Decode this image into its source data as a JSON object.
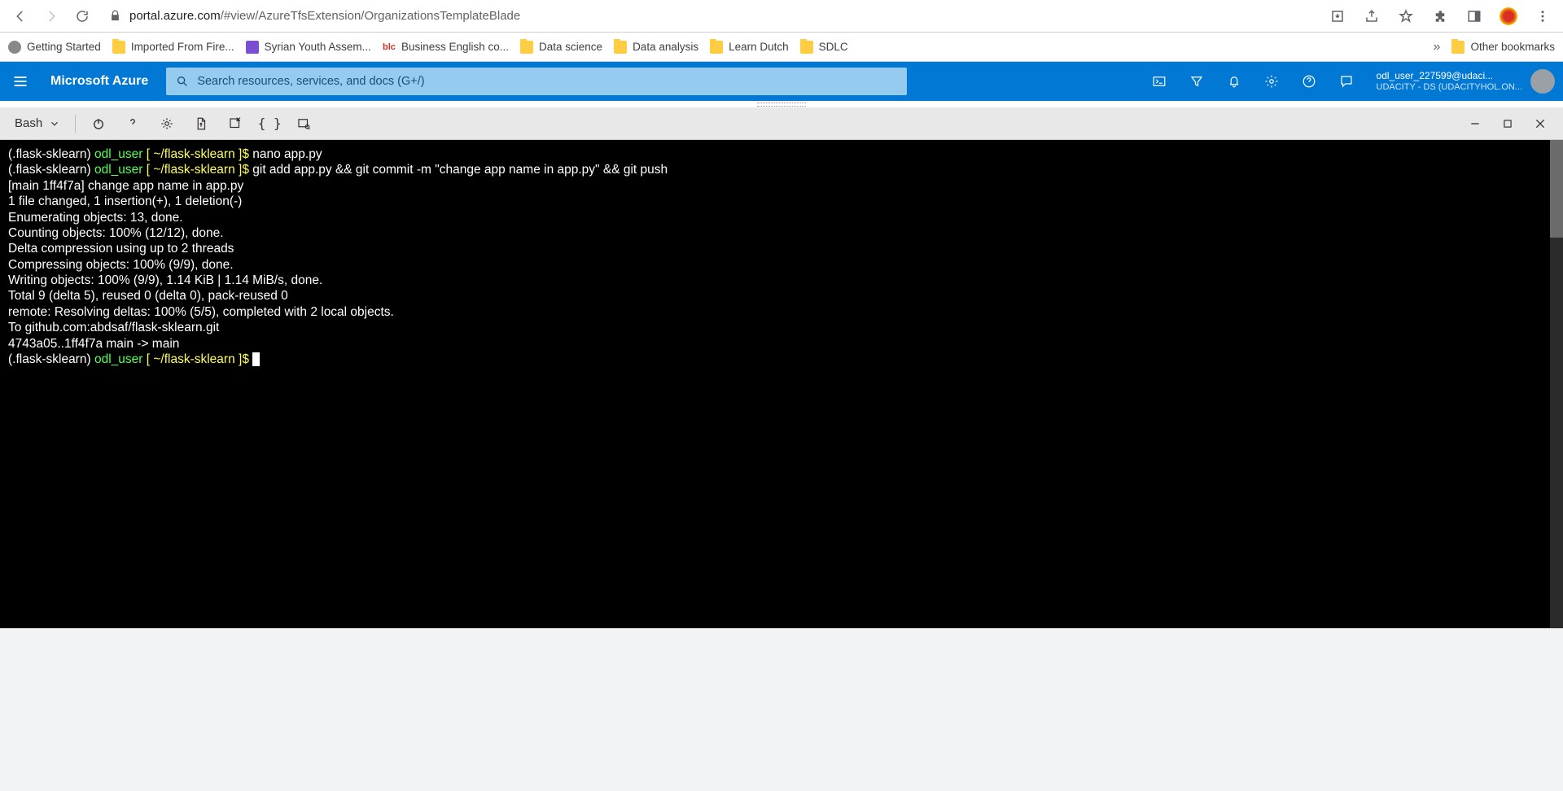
{
  "browser": {
    "url_locked": true,
    "url_host": "portal.azure.com",
    "url_path": "/#view/AzureTfsExtension/OrganizationsTemplateBlade"
  },
  "bookmarks": {
    "items": [
      {
        "label": "Getting Started",
        "iconType": "globe"
      },
      {
        "label": "Imported From Fire...",
        "iconType": "folder"
      },
      {
        "label": "Syrian Youth Assem...",
        "iconType": "purple"
      },
      {
        "label": "Business English co...",
        "iconType": "red"
      },
      {
        "label": "Data science",
        "iconType": "folder"
      },
      {
        "label": "Data analysis",
        "iconType": "folder"
      },
      {
        "label": "Learn Dutch",
        "iconType": "folder"
      },
      {
        "label": "SDLC",
        "iconType": "folder"
      }
    ],
    "overflow": "»",
    "other": "Other bookmarks"
  },
  "azure": {
    "brand": "Microsoft Azure",
    "search_placeholder": "Search resources, services, and docs (G+/)",
    "account_line1": "odl_user_227599@udaci...",
    "account_line2": "UDACITY - DS (UDACITYHOL.ON..."
  },
  "cloudshell": {
    "shell": "Bash"
  },
  "terminal": {
    "prompts": [
      {
        "env": "(.flask-sklearn)",
        "user": "odl_user",
        "sep1": " [ ",
        "path": "~/flask-sklearn",
        "sep2": " ]$ ",
        "cmd": "nano app.py"
      },
      {
        "env": "(.flask-sklearn)",
        "user": "odl_user",
        "sep1": " [ ",
        "path": "~/flask-sklearn",
        "sep2": " ]$ ",
        "cmd": "git add app.py && git commit -m \"change app name in app.py\" && git push"
      }
    ],
    "output": [
      "[main 1ff4f7a] change app name in app.py",
      " 1 file changed, 1 insertion(+), 1 deletion(-)",
      "Enumerating objects: 13, done.",
      "Counting objects: 100% (12/12), done.",
      "Delta compression using up to 2 threads",
      "Compressing objects: 100% (9/9), done.",
      "Writing objects: 100% (9/9), 1.14 KiB | 1.14 MiB/s, done.",
      "Total 9 (delta 5), reused 0 (delta 0), pack-reused 0",
      "remote: Resolving deltas: 100% (5/5), completed with 2 local objects.",
      "To github.com:abdsaf/flask-sklearn.git",
      "   4743a05..1ff4f7a  main -> main"
    ],
    "final_prompt": {
      "env": "(.flask-sklearn)",
      "user": "odl_user",
      "sep1": " [ ",
      "path": "~/flask-sklearn",
      "sep2": " ]$ ",
      "cmd": ""
    }
  }
}
